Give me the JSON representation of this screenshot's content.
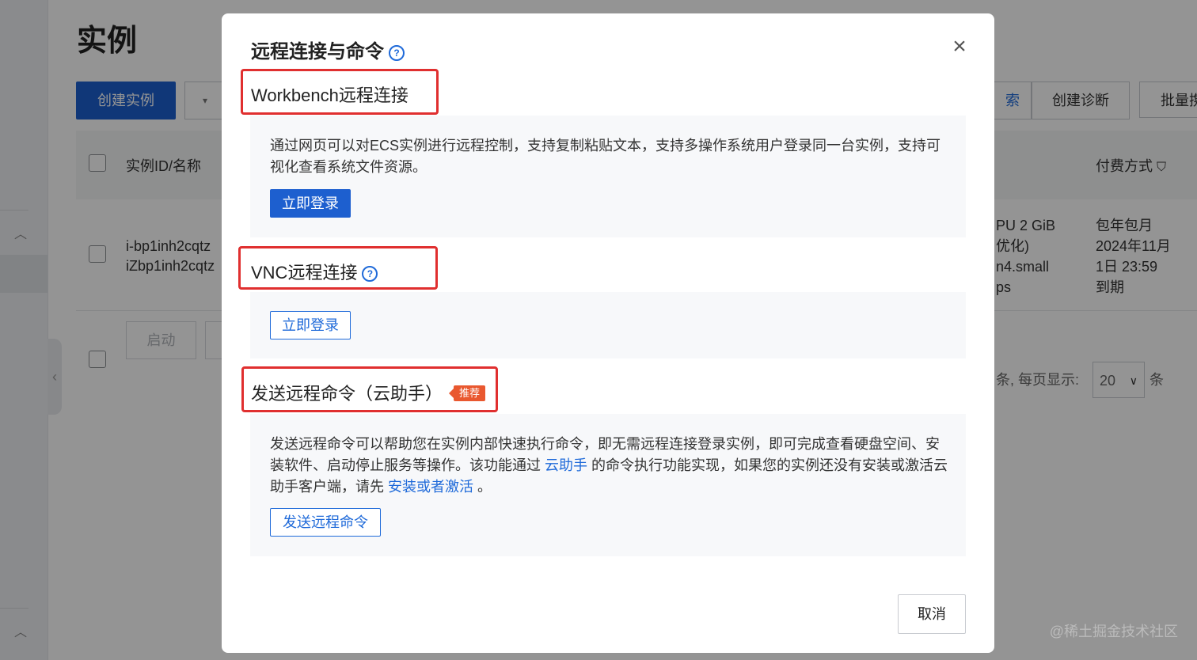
{
  "background": {
    "page_title": "实例",
    "create_button": "创建实例",
    "dropdown_caret": "▾",
    "search_partial": "索",
    "create_diagnosis_button": "创建诊断",
    "batch_button_partial": "批量携",
    "table_headers": {
      "id_name": "实例ID/名称",
      "payment": "付费方式"
    },
    "row": {
      "instance_id": "i-bp1inh2cqtz",
      "instance_name": "iZbp1inh2cqtz",
      "spec_line1": "PU 2 GiB",
      "spec_line2": "优化)",
      "spec_line3": "n4.small",
      "spec_line4": "ps",
      "payment_line1": "包年包月",
      "payment_line2": "2024年11月",
      "payment_line3": "1日 23:59",
      "payment_line4": "到期"
    },
    "start_button": "启动",
    "pagination_text": "条, 每页显示:",
    "page_size": "20",
    "pagination_suffix": "条",
    "watermark": "@稀土掘金技术社区"
  },
  "modal": {
    "title": "远程连接与命令",
    "help": "?",
    "close": "×",
    "workbench": {
      "title": "Workbench远程连接",
      "description": "通过网页可以对ECS实例进行远程控制，支持复制粘贴文本，支持多操作系统用户登录同一台实例，支持可视化查看系统文件资源。",
      "login_button": "立即登录"
    },
    "vnc": {
      "title": "VNC远程连接",
      "login_button": "立即登录"
    },
    "command": {
      "title": "发送远程命令（云助手）",
      "badge": "推荐",
      "desc_part1": "发送远程命令可以帮助您在实例内部快速执行命令，即无需远程连接登录实例，即可完成查看硬盘空间、安装软件、启动停止服务等操作。该功能通过",
      "link1": "云助手",
      "desc_part2": "的命令执行功能实现，如果您的实例还没有安装或激活云助手客户端，请先",
      "link2": "安装或者激活",
      "desc_part3": "。",
      "send_button": "发送远程命令"
    },
    "cancel": "取消"
  }
}
